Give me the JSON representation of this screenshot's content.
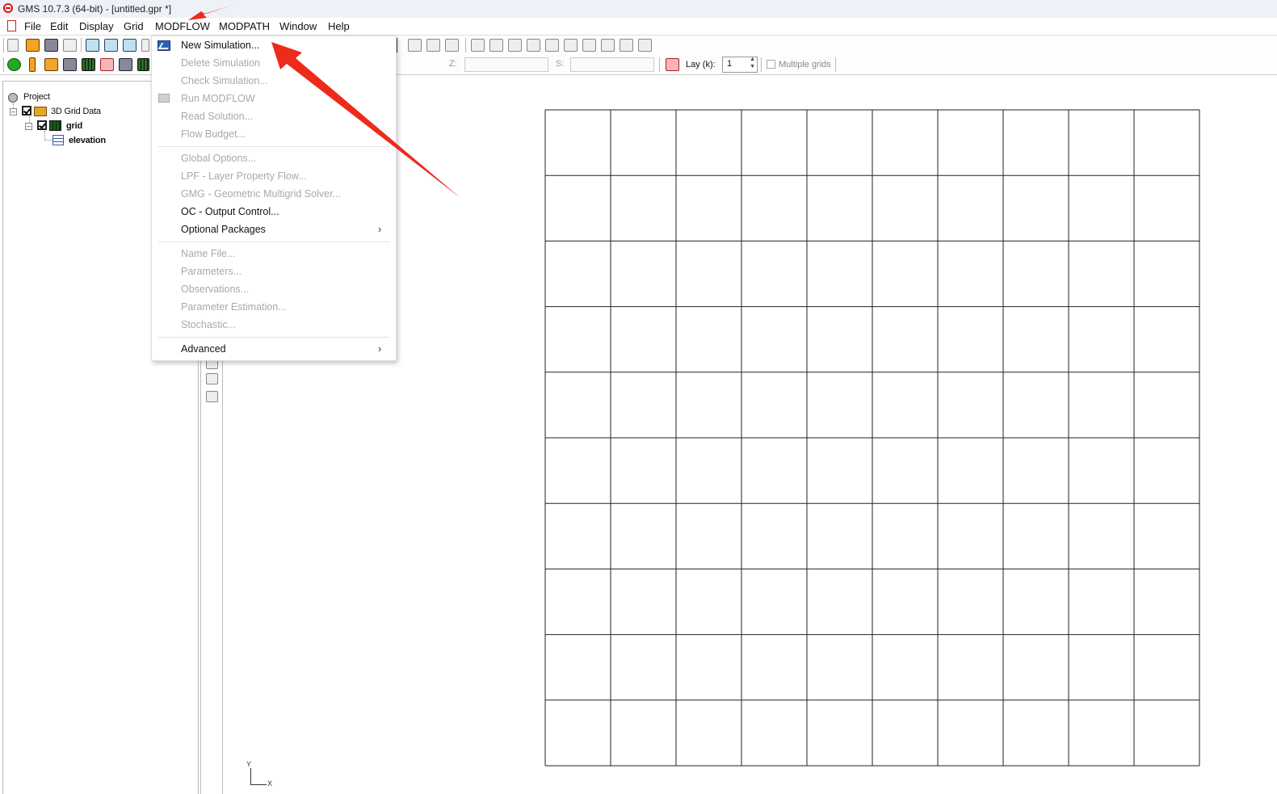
{
  "window": {
    "title": "GMS 10.7.3 (64-bit) - [untitled.gpr *]"
  },
  "menubar": {
    "items": [
      "File",
      "Edit",
      "Display",
      "Grid",
      "MODFLOW",
      "MODPATH",
      "Window",
      "Help"
    ]
  },
  "toolbar2": {
    "z_label": "Z:",
    "s_label": "S:",
    "layer_label": "Lay (k):",
    "layer_value": "1",
    "multiple_grids_label": "Multiple grids"
  },
  "project_tree": {
    "root": "Project",
    "grid_data": "3D Grid Data",
    "grid": "grid",
    "dataset": "elevation"
  },
  "modflow_menu": {
    "new_simulation": "New Simulation...",
    "delete_simulation": "Delete Simulation",
    "check_simulation": "Check Simulation...",
    "run_modflow": "Run MODFLOW",
    "read_solution": "Read Solution...",
    "flow_budget": "Flow Budget...",
    "global_options": "Global Options...",
    "lpf": "LPF - Layer Property Flow...",
    "gmg": "GMG - Geometric Multigrid Solver...",
    "oc": "OC - Output Control...",
    "optional_packages": "Optional Packages",
    "name_file": "Name File...",
    "parameters": "Parameters...",
    "observations": "Observations...",
    "parameter_estimation": "Parameter Estimation...",
    "stochastic": "Stochastic...",
    "advanced": "Advanced",
    "submenu_arrow": "›"
  },
  "axis_triad": {
    "y": "Y",
    "x": "X"
  },
  "grid_view": {
    "columns": 10,
    "rows": 10
  },
  "colors": {
    "annotation_arrow": "#ee2a1b",
    "highlight_icon": "#2a64b8"
  }
}
